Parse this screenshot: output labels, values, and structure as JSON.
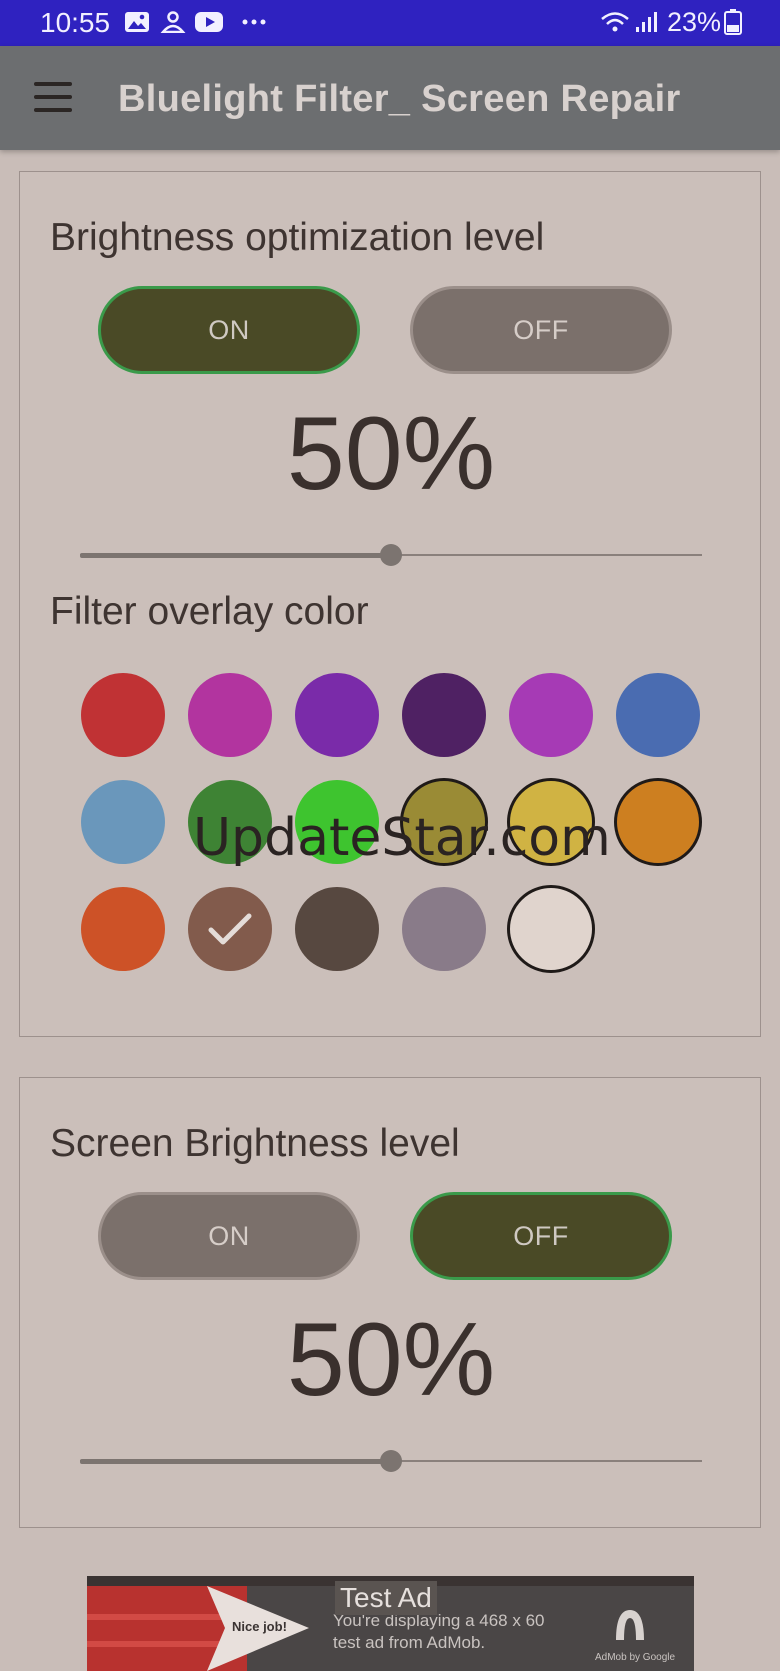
{
  "status_bar": {
    "time": "10:55",
    "icons": [
      "gallery-icon",
      "person-icon",
      "youtube-icon",
      "more-icon",
      "wifi-icon",
      "signal-icon",
      "battery-icon"
    ],
    "battery": "23%",
    "background": "#2f22c0"
  },
  "app_bar": {
    "title": "Bluelight Filter_ Screen Repair",
    "menu_icon": "hamburger-menu-icon"
  },
  "brightness_optimization": {
    "heading": "Brightness optimization level",
    "on_label": "ON",
    "off_label": "OFF",
    "selected": "ON",
    "percent_text": "50%",
    "slider_value": 0.5
  },
  "filter_overlay": {
    "heading": "Filter overlay color",
    "selected_index": 13,
    "colors": [
      "#c03234",
      "#b2349f",
      "#7a2ba9",
      "#4f2163",
      "#a63ab5",
      "#4a6cb1",
      "#6a97bb",
      "#3e8334",
      "#3ec42f",
      "#9a8b35",
      "#d0b343",
      "#cd7f20",
      "#cd5227",
      "#825b4c",
      "#574840",
      "#897b89",
      "#e0d4cd"
    ]
  },
  "watermark": "UpdateStar.com",
  "screen_brightness": {
    "heading": "Screen Brightness level",
    "on_label": "ON",
    "off_label": "OFF",
    "selected": "OFF",
    "percent_text": "50%",
    "slider_value": 0.5
  },
  "ad": {
    "label": "Test Ad",
    "text": "You're displaying a 468 x 60 test ad from AdMob.",
    "badge": "Nice job!",
    "brand": "AdMob by Google"
  }
}
